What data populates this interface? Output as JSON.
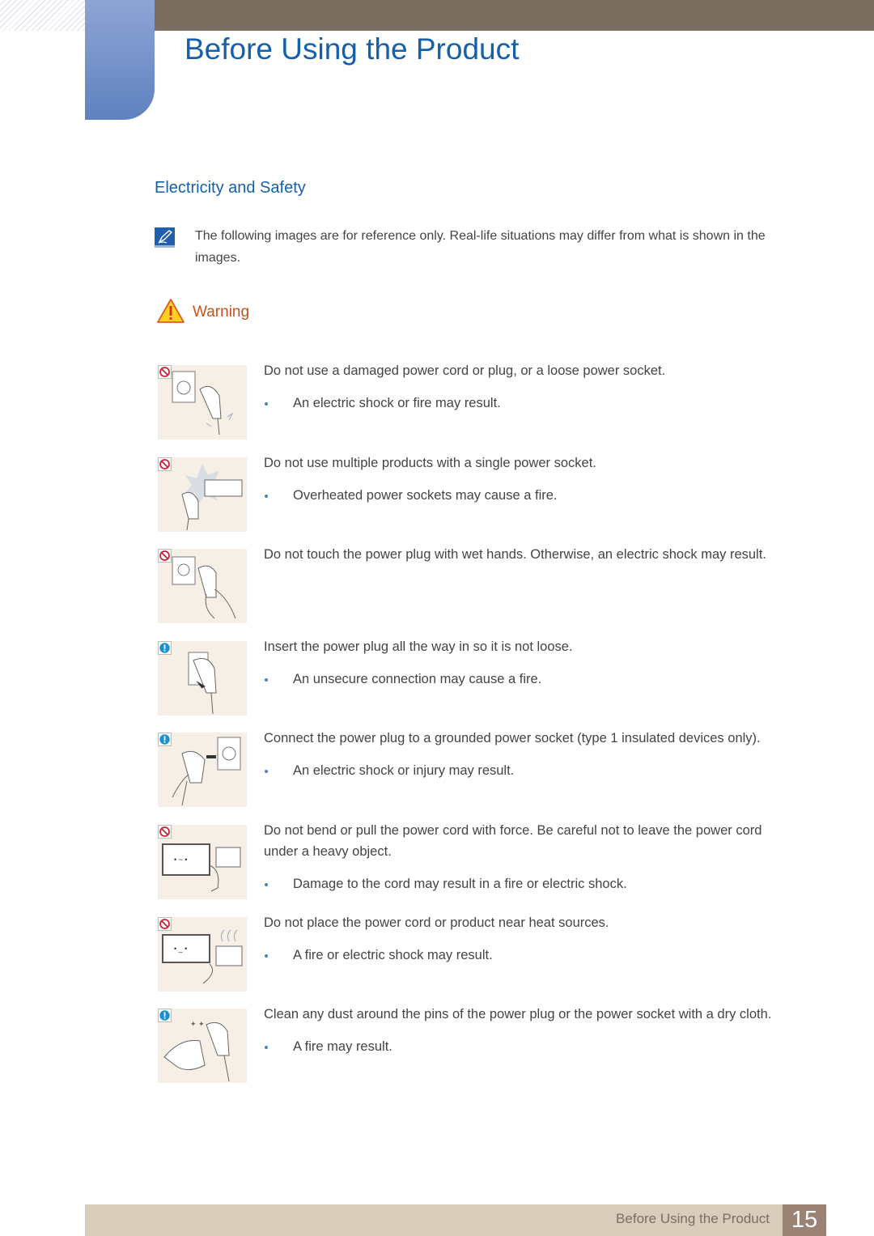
{
  "header": {
    "title": "Before Using the Product"
  },
  "section": {
    "title": "Electricity and Safety"
  },
  "note": {
    "icon": "note-pencil-icon",
    "text": "The following images are for reference only. Real-life situations may differ from what is shown in the images."
  },
  "warning": {
    "icon": "warning-triangle-icon",
    "label": "Warning",
    "color": "#c0531d"
  },
  "items": [
    {
      "badge": "prohibited",
      "illustration": "damaged-plug-socket",
      "text": "Do not use a damaged power cord or plug, or a loose power socket.",
      "bullets": [
        "An electric shock or fire may result."
      ]
    },
    {
      "badge": "prohibited",
      "illustration": "overloaded-power-strip",
      "text": "Do not use multiple products with a single power socket.",
      "bullets": [
        "Overheated power sockets may cause a fire."
      ]
    },
    {
      "badge": "prohibited",
      "illustration": "wet-hand-plug",
      "text": "Do not touch the power plug with wet hands. Otherwise, an electric shock may result.",
      "bullets": []
    },
    {
      "badge": "mandatory",
      "illustration": "insert-plug-fully",
      "text": "Insert the power plug all the way in so it is not loose.",
      "bullets": [
        "An unsecure connection may cause a fire."
      ]
    },
    {
      "badge": "mandatory",
      "illustration": "grounded-socket",
      "text": "Connect the power plug to a grounded power socket (type 1 insulated devices only).",
      "bullets": [
        "An electric shock or injury may result."
      ]
    },
    {
      "badge": "prohibited",
      "illustration": "cord-under-heavy-object",
      "text": "Do not bend or pull the power cord with force. Be careful not to leave the power cord under a heavy object.",
      "bullets": [
        "Damage to the cord may result in a fire or electric shock."
      ]
    },
    {
      "badge": "prohibited",
      "illustration": "heat-source",
      "text": "Do not place the power cord or product near heat sources.",
      "bullets": [
        "A fire or electric shock may result."
      ]
    },
    {
      "badge": "mandatory",
      "illustration": "clean-plug-dust",
      "text": "Clean any dust around the pins of the power plug or the power socket with a dry cloth.",
      "bullets": [
        "A fire may result."
      ]
    }
  ],
  "footer": {
    "label": "Before Using the Product",
    "page": "15"
  },
  "colors": {
    "title_blue": "#1460aa",
    "top_bar": "#7b6e61",
    "footer_bar": "#d8ccba",
    "page_box": "#9a8275",
    "prohibited_red": "#c2263a",
    "mandatory_blue": "#1c8fd0"
  }
}
